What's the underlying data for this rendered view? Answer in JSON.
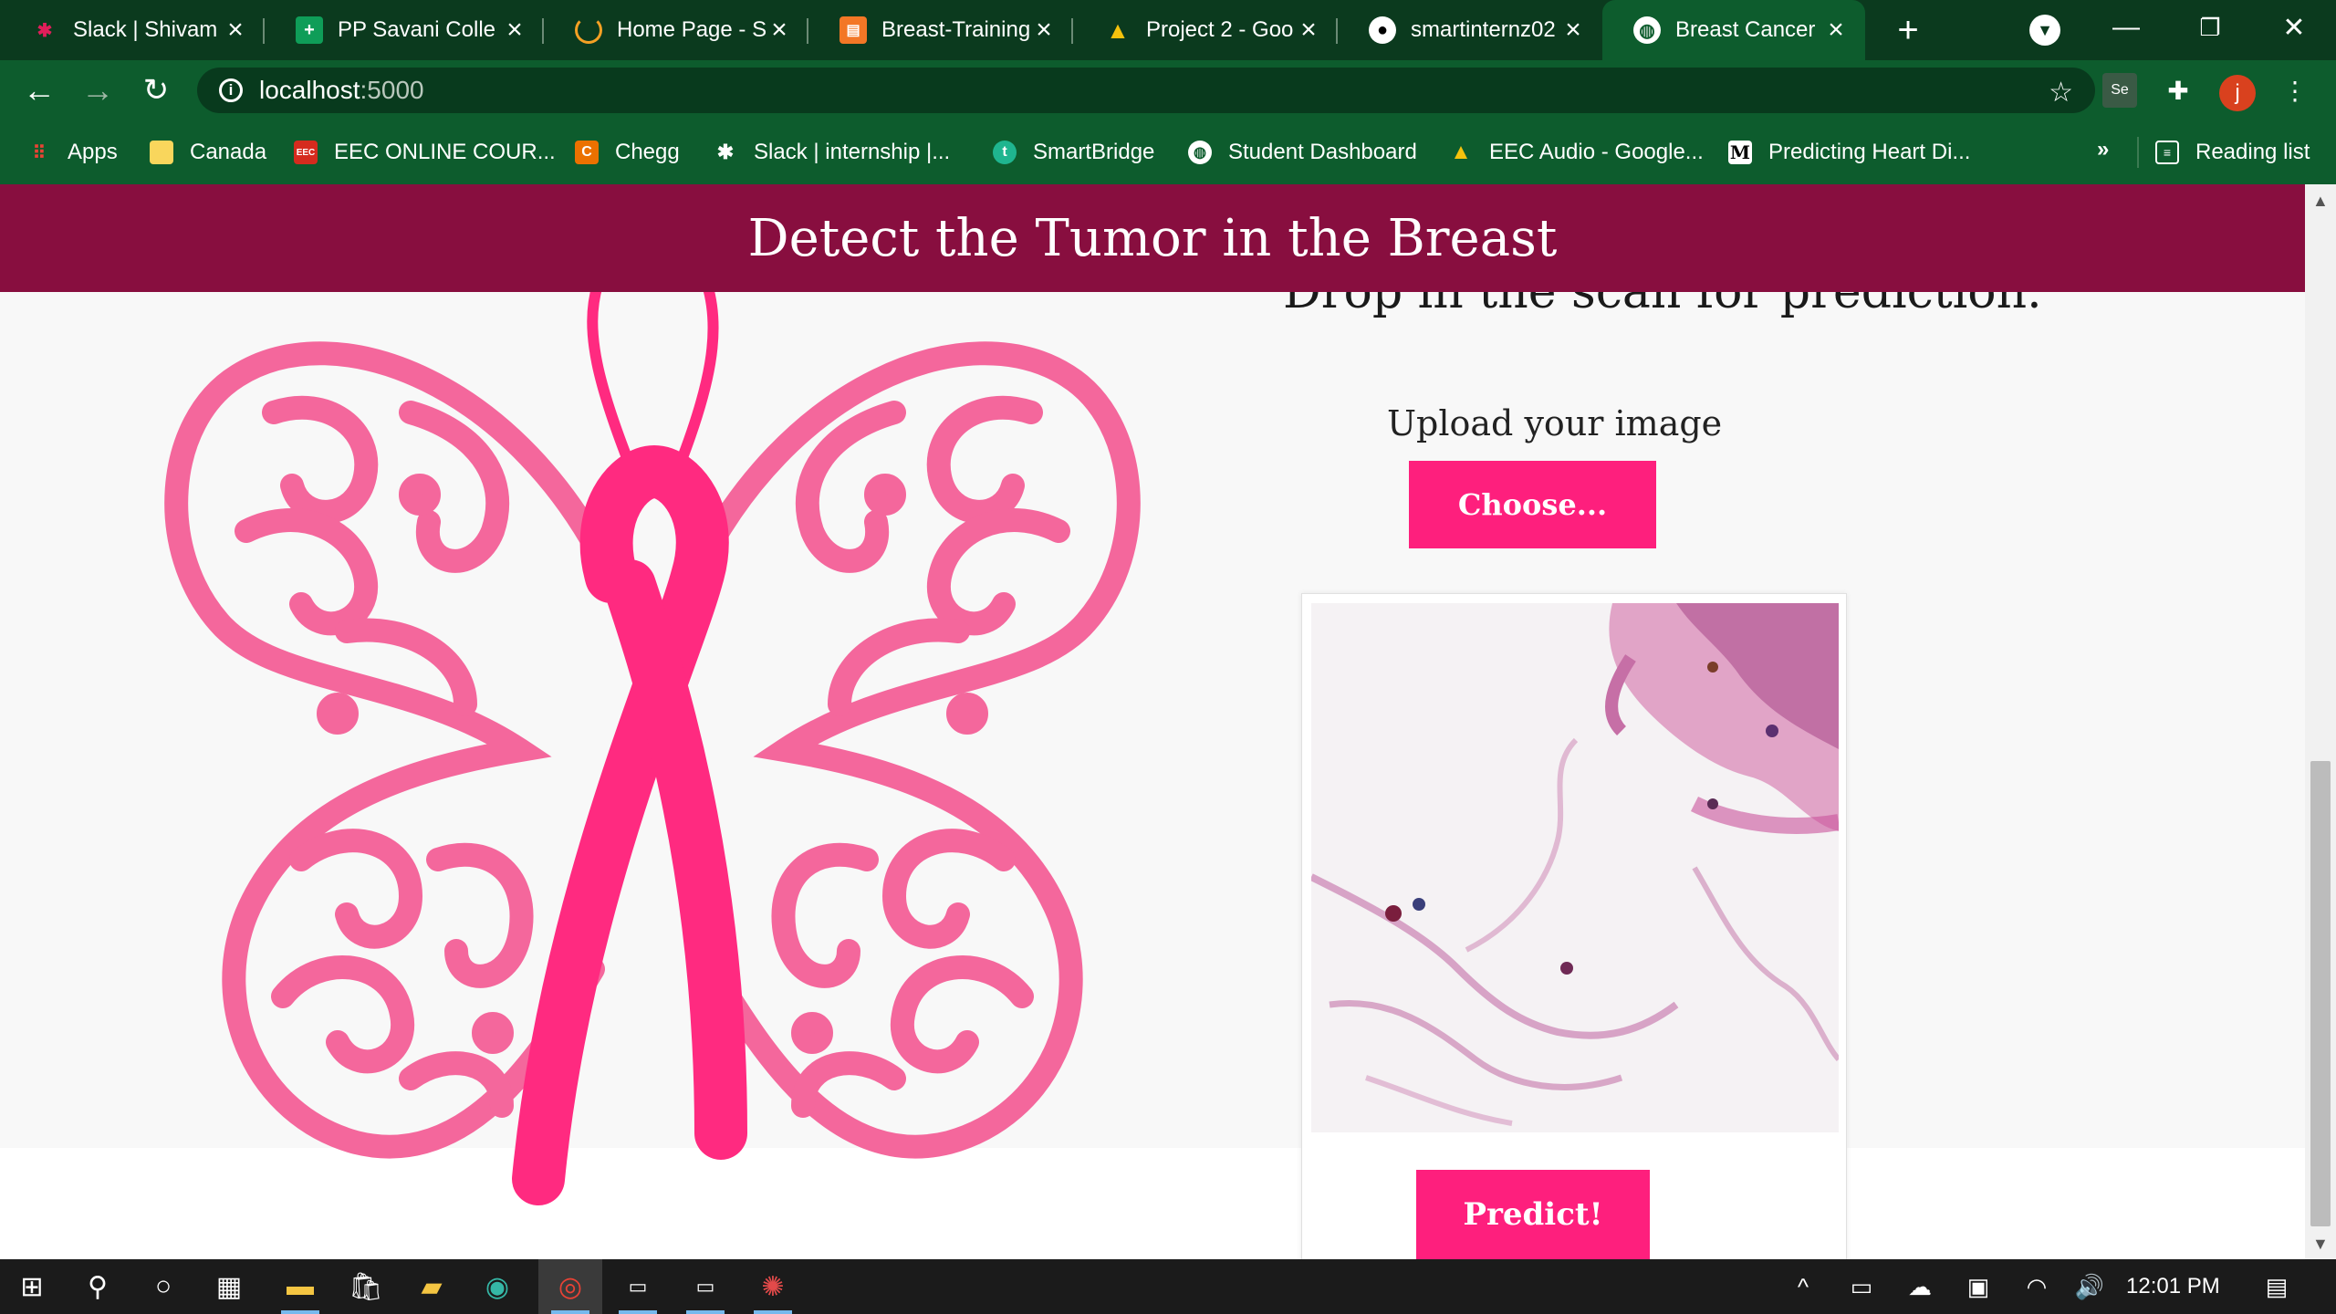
{
  "browser": {
    "tabs": [
      {
        "title": "Slack | Shivam S",
        "icon": "slack-icon",
        "active": false
      },
      {
        "title": "PP Savani Colle",
        "icon": "sheets-icon",
        "active": false
      },
      {
        "title": "Home Page - S",
        "icon": "loading-icon",
        "active": false
      },
      {
        "title": "Breast-Training",
        "icon": "notebook-icon",
        "active": false
      },
      {
        "title": "Project 2 - Goo",
        "icon": "drive-icon",
        "active": false
      },
      {
        "title": "smartinternz02",
        "icon": "github-icon",
        "active": false
      },
      {
        "title": "Breast Cancer D",
        "icon": "globe-icon",
        "active": true
      }
    ],
    "new_tab": "+",
    "address": {
      "host": "localhost",
      "port": ":5000"
    },
    "profile_initial": "j",
    "bookmarks": [
      {
        "label": "Apps",
        "icon": "apps-grid-icon"
      },
      {
        "label": "Canada",
        "icon": "folder-icon"
      },
      {
        "label": "EEC ONLINE COUR...",
        "icon": "eec-icon"
      },
      {
        "label": "Chegg",
        "icon": "chegg-icon"
      },
      {
        "label": "Slack | internship |...",
        "icon": "slack-icon"
      },
      {
        "label": "SmartBridge",
        "icon": "smartbridge-icon"
      },
      {
        "label": "Student Dashboard",
        "icon": "globe-icon"
      },
      {
        "label": "EEC Audio - Google...",
        "icon": "drive-icon"
      },
      {
        "label": "Predicting Heart Di...",
        "icon": "medium-icon"
      }
    ],
    "bookmarks_more": "»",
    "reading_list": "Reading list"
  },
  "page": {
    "header_title": "Detect the Tumor in the Breast",
    "drop_text": "Drop in the scan for prediction.",
    "upload_label": "Upload your image",
    "choose_button": "Choose...",
    "predict_button": "Predict!"
  },
  "colors": {
    "header_band": "#880e3f",
    "accent_pink": "#fe1f7d",
    "butterfly_pink": "#f4679c",
    "ribbon_pink": "#ff2a80"
  },
  "taskbar": {
    "clock": "12:01 PM"
  }
}
